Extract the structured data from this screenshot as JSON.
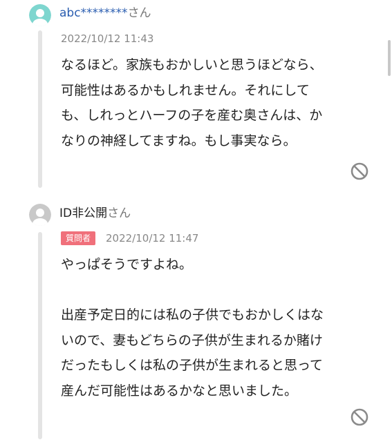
{
  "answer1": {
    "user_id": "abc********",
    "user_suffix": "さん",
    "timestamp": "2022/10/12 11:43",
    "lines": [
      "なるほど。家族もおかしいと思うほどなら、",
      "可能性はあるかもしれません。それにして",
      "も、しれっとハーフの子を産む奥さんは、か",
      "なりの神経してますね。もし事実なら。"
    ]
  },
  "answer2": {
    "user_id": "ID非公開",
    "user_suffix": "さん",
    "badge": "質問者",
    "timestamp": "2022/10/12 11:47",
    "paragraphs": [
      [
        "やっぱそうですよね。"
      ],
      [
        "出産予定日的には私の子供でもおかしくはな",
        "いので、妻もどちらの子供が生まれるか賭け",
        "だったもしくは私の子供が生まれると思って",
        "産んだ可能性はあるかなと思いました。"
      ]
    ]
  },
  "colors": {
    "accent_link": "#2a5db0",
    "badge_bg": "#f0707b",
    "avatar_teal": "#7ed6cf",
    "avatar_gray": "#c9c9c9"
  },
  "icons": {
    "report": "prohibited-circle-icon",
    "avatar": "user-silhouette-icon"
  }
}
